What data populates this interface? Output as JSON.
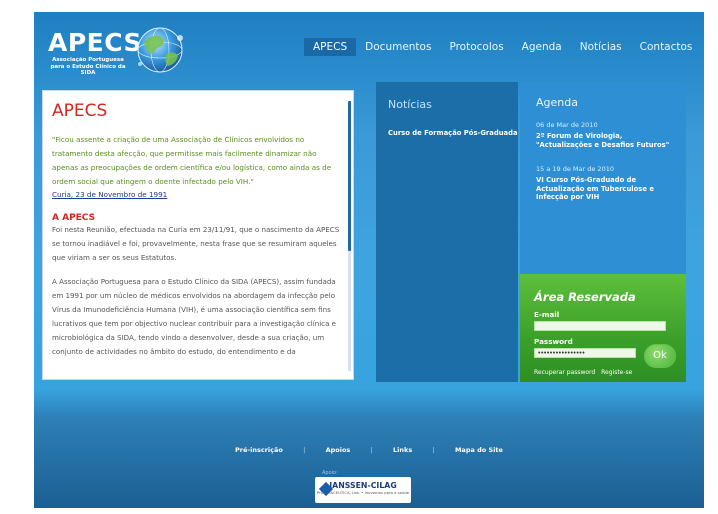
{
  "logo": {
    "title": "APECS",
    "subtitle": "Associação Portuguesa para o Estudo Clínico da SIDA"
  },
  "nav": {
    "items": [
      "APECS",
      "Documentos",
      "Protocolos",
      "Agenda",
      "Notícias",
      "Contactos"
    ],
    "active": "APECS"
  },
  "article": {
    "title": "APECS",
    "quote": "\"Ficou assente a criação de uma Associação de Clínicos envolvidos no tratamento desta afecção, que permitisse mais facilmente dinamizar não apenas as preocupações de ordem científica e/ou logística, como ainda as de ordem social que atingem o doente infectado pelo VIH.\"",
    "quote_source": "Curia, 23 de Novembro de 1991",
    "subtitle": "A APECS",
    "paragraphs": [
      "Foi nesta Reunião, efectuada na Curia em 23/11/91, que o nascimento da APECS se tornou inadiável e foi, provavelmente, nesta frase que se resumiram aqueles que viriam a ser os seus Estatutos.",
      "A Associação Portuguesa para o Estudo Clínico da SIDA (APECS), assim fundada em 1991 por um núcleo de médicos envolvidos na abordagem da infecção pelo Vírus da Imunodeficiência Humana (VIH), é uma associação científica sem fins lucrativos que tem por objectivo nuclear contribuir para a investigação clínica e microbiológica da SIDA, tendo vindo a desenvolver, desde a sua criação, um conjunto de actividades no âmbito do estudo, do entendimento e da"
    ]
  },
  "news": {
    "title": "Notícias",
    "items": [
      "Curso de Formação Pós-Graduada"
    ]
  },
  "agenda": {
    "title": "Agenda",
    "events": [
      {
        "date": "06 de Mar de 2010",
        "text": "2º Forum de Virologia, \"Actualizações e Desafios Futuros\""
      },
      {
        "date": "15 a 19 de Mar de 2010",
        "text": "VI Curso Pós-Graduado de Actualização em Tuberculose e Infecção por VIH"
      }
    ]
  },
  "reserved": {
    "title": "Área Reservada",
    "email_label": "E-mail",
    "email_value": "",
    "password_label": "Password",
    "password_value": "••••••••••••••••",
    "ok_label": "Ok",
    "recover_link": "Recuperar password",
    "register_link": "Registe-se"
  },
  "footer": {
    "links": [
      "Pré-inscrição",
      "Apoios",
      "Links",
      "Mapa do Site"
    ],
    "separator": "|",
    "support_label": "Apoio:",
    "sponsor_name": "JANSSEN-CILAG",
    "sponsor_tagline": "PHARMACEUTICA, Lda. • inovamos para a saúde"
  },
  "colors": {
    "accent_red": "#d0281e",
    "quote_green": "#5a8d1e",
    "nav_active": "#1a68a6",
    "reserved_green": "#3aa02a"
  }
}
